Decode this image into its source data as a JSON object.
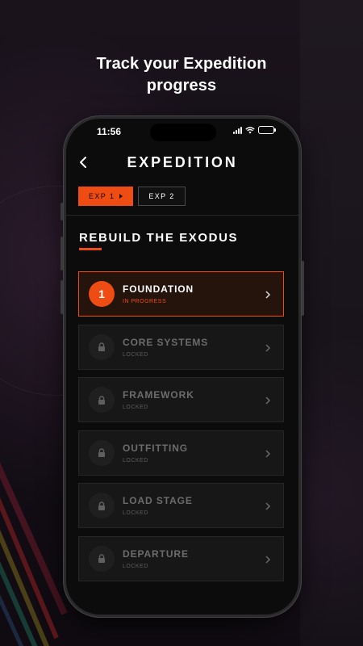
{
  "headline": {
    "line1": "Track your Expedition",
    "line2": "progress"
  },
  "status_bar": {
    "time": "11:56"
  },
  "header": {
    "title": "EXPEDITION"
  },
  "tabs": [
    {
      "label": "EXP 1",
      "active": true
    },
    {
      "label": "EXP 2",
      "active": false
    }
  ],
  "section": {
    "title": "REBUILD THE EXODUS"
  },
  "stages": [
    {
      "number": "1",
      "name": "FOUNDATION",
      "status": "IN PROGRESS",
      "active": true
    },
    {
      "name": "CORE SYSTEMS",
      "status": "LOCKED",
      "active": false
    },
    {
      "name": "FRAMEWORK",
      "status": "LOCKED",
      "active": false
    },
    {
      "name": "OUTFITTING",
      "status": "LOCKED",
      "active": false
    },
    {
      "name": "LOAD STAGE",
      "status": "LOCKED",
      "active": false
    },
    {
      "name": "DEPARTURE",
      "status": "LOCKED",
      "active": false
    }
  ],
  "colors": {
    "accent": "#ee4c13",
    "background": "#0c0c0c",
    "card": "#171717"
  }
}
